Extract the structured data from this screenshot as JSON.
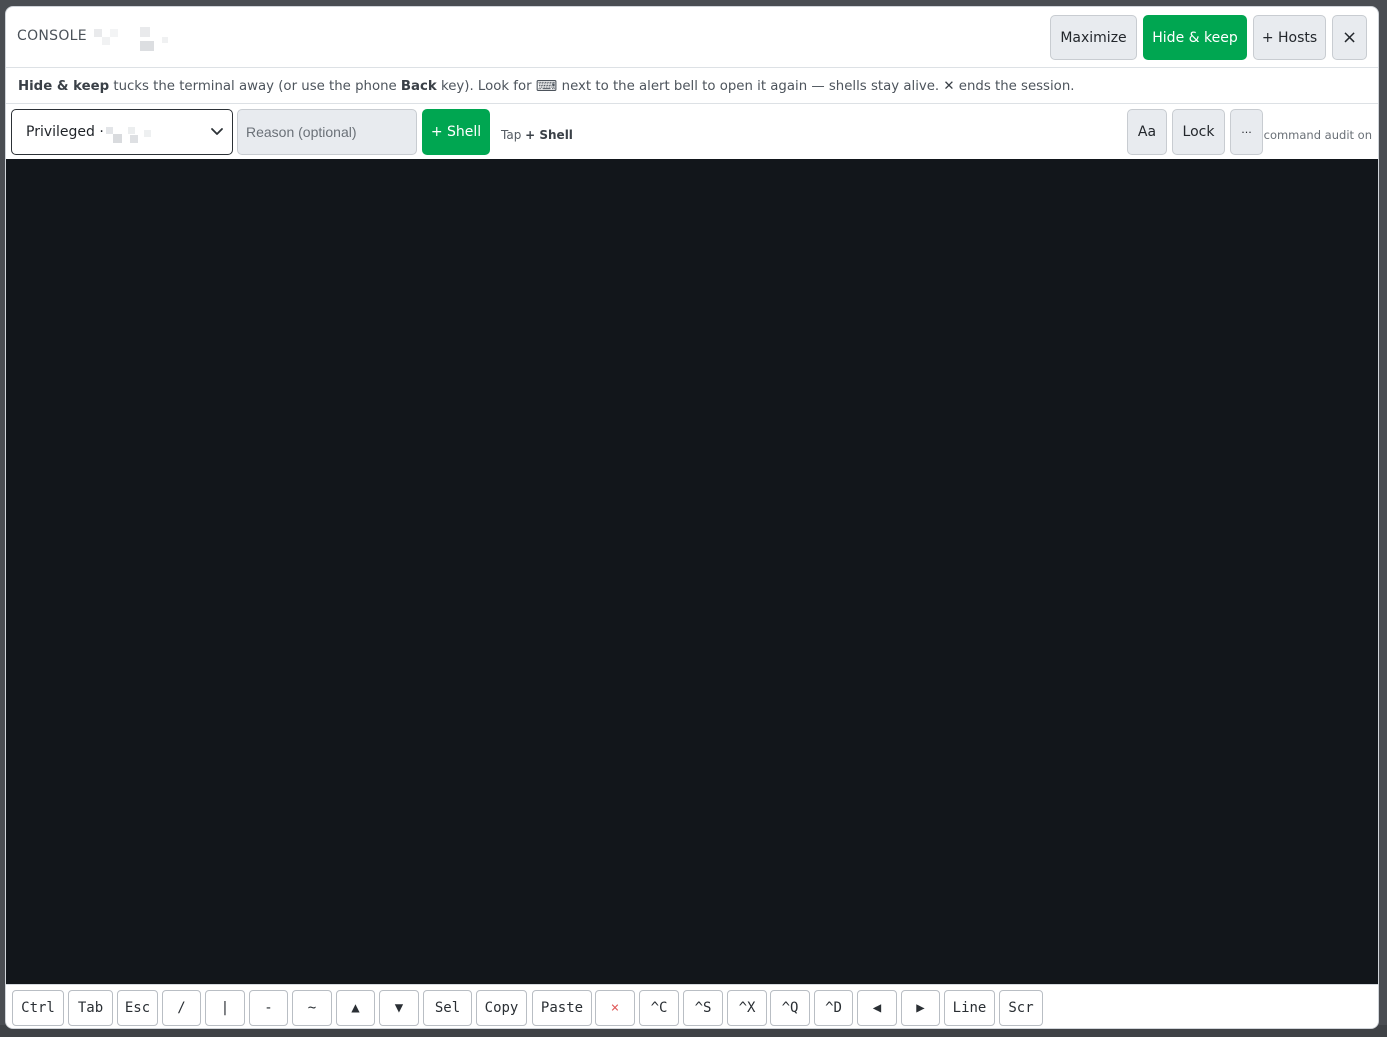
{
  "header": {
    "title": "CONSOLE",
    "maximize_label": "Maximize",
    "hide_keep_label": "Hide & keep",
    "hosts_label": "+ Hosts",
    "close_label": "×"
  },
  "info": {
    "b1": "Hide & keep",
    "t1": " tucks the terminal away (or use the phone ",
    "b2": "Back",
    "t2": " key). Look for ",
    "keyboard_glyph": "⌨",
    "t3": " next to the alert bell to open it again — shells stay alive. ",
    "close_glyph": "✕",
    "t4": " ends the session."
  },
  "toolbar": {
    "mode_value": "Privileged ·",
    "reason_placeholder": "Reason (optional)",
    "shell_label": "+ Shell",
    "tap_prefix": "Tap ",
    "tap_bold": "+ Shell",
    "font_label": "Aa",
    "lock_label": "Lock",
    "more_label": "···",
    "audit_text": "command audit on"
  },
  "keys": [
    "Ctrl",
    "Tab",
    "Esc",
    "/",
    "|",
    "-",
    "~",
    "▲",
    "▼",
    "Sel",
    "Copy",
    "Paste",
    "×",
    "^C",
    "^S",
    "^X",
    "^Q",
    "^D",
    "◀",
    "▶",
    "Line",
    "Scr"
  ],
  "colors": {
    "accent_green": "#00a651",
    "terminal_bg": "#12161b",
    "danger_red": "#e05a5a"
  }
}
